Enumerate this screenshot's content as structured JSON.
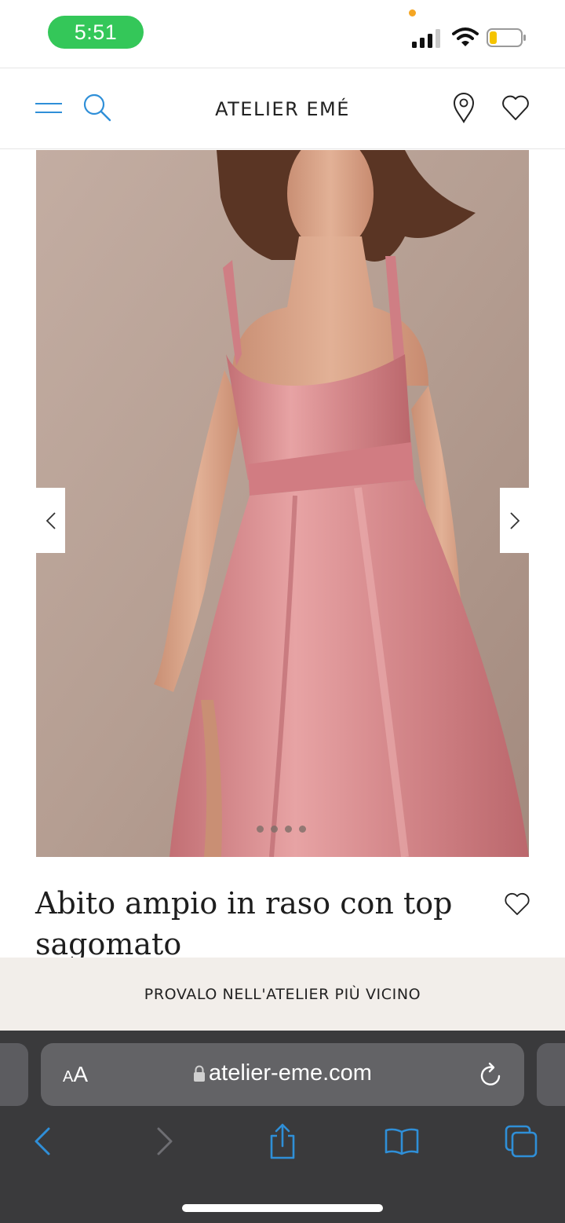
{
  "status_bar": {
    "time": "5:51"
  },
  "header": {
    "brand": "ATELIER EMÉ",
    "icons": [
      "menu-icon",
      "search-icon",
      "location-pin-icon",
      "heart-icon"
    ]
  },
  "gallery": {
    "image_count": 4,
    "active_index": 0,
    "prev_icon": "chevron-left-icon",
    "next_icon": "chevron-right-icon"
  },
  "product": {
    "title": "Abito ampio in raso con top sagomato"
  },
  "cta": {
    "label": "PROVALO NELL'ATELIER PIÙ VICINO"
  },
  "browser": {
    "aa_label_small": "A",
    "aa_label_big": "A",
    "url": "atelier-eme.com",
    "toolbar_icons": [
      "back-icon",
      "forward-icon",
      "share-icon",
      "bookmarks-icon",
      "tabs-icon"
    ]
  },
  "colors": {
    "accent_blue": "#2f8fd8",
    "status_green": "#34c759",
    "cta_background": "#f2eeea",
    "dress_pink": "#d4868a",
    "safari_bar": "#3a3a3c"
  }
}
